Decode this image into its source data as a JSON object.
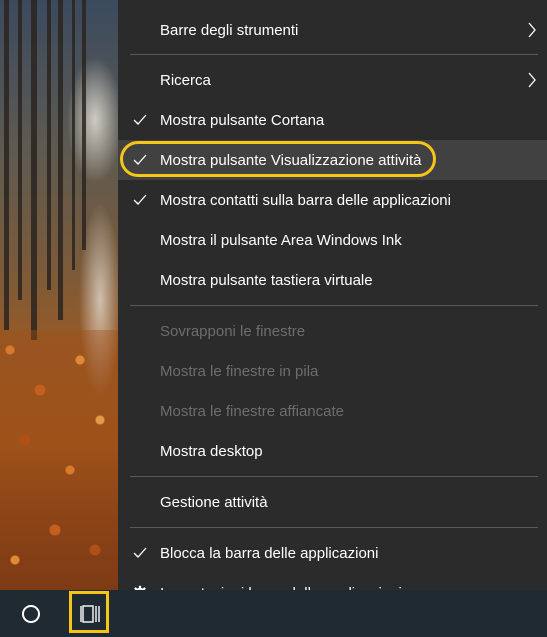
{
  "menu": {
    "items": {
      "toolbars": {
        "label": "Barre degli strumenti",
        "checked": false,
        "submenu": true,
        "enabled": true
      },
      "search": {
        "label": "Ricerca",
        "checked": false,
        "submenu": true,
        "enabled": true
      },
      "cortana": {
        "label": "Mostra pulsante Cortana",
        "checked": true,
        "enabled": true
      },
      "task_view": {
        "label": "Mostra pulsante Visualizzazione attività",
        "checked": true,
        "enabled": true,
        "highlighted": true
      },
      "people": {
        "label": "Mostra contatti sulla barra delle applicazioni",
        "checked": true,
        "enabled": true
      },
      "ink": {
        "label": "Mostra il pulsante Area Windows Ink",
        "checked": false,
        "enabled": true
      },
      "keyboard": {
        "label": "Mostra pulsante tastiera virtuale",
        "checked": false,
        "enabled": true
      },
      "cascade": {
        "label": "Sovrapponi le finestre",
        "enabled": false
      },
      "stacked": {
        "label": "Mostra le finestre in pila",
        "enabled": false
      },
      "side_by_side": {
        "label": "Mostra le finestre affiancate",
        "enabled": false
      },
      "desktop": {
        "label": "Mostra desktop",
        "enabled": true
      },
      "task_manager": {
        "label": "Gestione attività",
        "enabled": true
      },
      "lock": {
        "label": "Blocca la barra delle applicazioni",
        "checked": true,
        "enabled": true
      },
      "settings": {
        "label": "Impostazioni barra delle applicazioni",
        "icon": "gear-icon",
        "enabled": true
      }
    }
  },
  "taskbar": {
    "cortana_icon": "cortana-circle-icon",
    "task_view_icon": "task-view-icon"
  },
  "colors": {
    "menu_background": "#2b2b2b",
    "highlight_background": "#414141",
    "disabled_text": "#6d6d6d",
    "annotation": "#f5c518",
    "taskbar": "#1f2a33"
  }
}
